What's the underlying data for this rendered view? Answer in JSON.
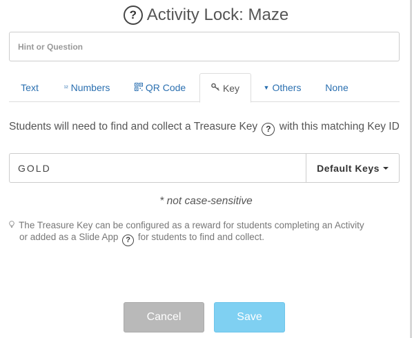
{
  "header": {
    "title": "Activity Lock: Maze",
    "help_glyph": "?"
  },
  "hint": {
    "placeholder": "Hint or Question",
    "value": ""
  },
  "tabs": [
    {
      "label": "Text",
      "icon": "",
      "active": false
    },
    {
      "label": "Numbers",
      "icon": "¹²",
      "active": false
    },
    {
      "label": "QR Code",
      "icon": "qr-code-icon",
      "active": false
    },
    {
      "label": "Key",
      "icon": "key-icon",
      "active": true
    },
    {
      "label": "Others",
      "icon": "caret-down-icon",
      "active": false
    },
    {
      "label": "None",
      "icon": "",
      "active": false
    }
  ],
  "description": {
    "before": "Students will need to find and collect a Treasure Key",
    "after": "with this matching Key ID"
  },
  "key_field": {
    "value": "GOLD",
    "dropdown_label": "Default Keys"
  },
  "case_note": "* not case-sensitive",
  "info": {
    "line1": "The Treasure Key can be configured as a reward for students completing an Activity",
    "line2_before": "or added as a Slide App",
    "line2_after": "for students to find and collect."
  },
  "footer": {
    "cancel_label": "Cancel",
    "save_label": "Save"
  },
  "colors": {
    "link": "#2a6fb0",
    "save": "#7fd0f2",
    "cancel": "#b9b9b9"
  }
}
